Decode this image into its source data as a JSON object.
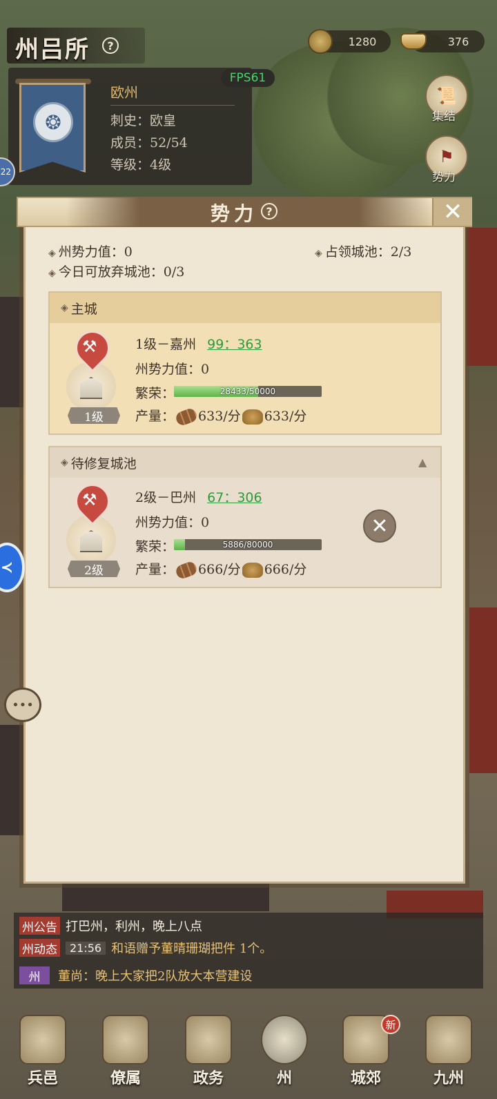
{
  "header": {
    "title": "州吕所",
    "help_icon": "?",
    "coins": "1280",
    "ingots": "376",
    "fps": "FPS61"
  },
  "state_card": {
    "name": "欧州",
    "governor": "刺史：欧皇",
    "members": "成员：52/54",
    "level": "等级：4级"
  },
  "side_buttons": {
    "rally": "集结",
    "power": "势力"
  },
  "left_avatar_level": "22",
  "modal": {
    "title": "势力",
    "close": "✕",
    "state_power": "州势力值：0",
    "occupied": "占领城池：2/3",
    "abandon_today": "今日可放弃城池：0/3",
    "sections": [
      {
        "heading": "主城",
        "city": {
          "level_badge": "1级",
          "name": "1级－嘉州",
          "coords": "99：363",
          "power": "州势力值：0",
          "prosperity_label": "繁荣：",
          "prosperity_text": "28433/50000",
          "prosperity_fraction": 0.5687,
          "output_label": "产量：",
          "wood": "633/分",
          "grain": "633/分"
        }
      },
      {
        "heading": "待修复城池",
        "city": {
          "level_badge": "2级",
          "name": "2级－巴州",
          "coords": "67：306",
          "power": "州势力值：0",
          "prosperity_label": "繁荣：",
          "prosperity_text": "5886/80000",
          "prosperity_fraction": 0.0736,
          "output_label": "产量：",
          "wood": "666/分",
          "grain": "666/分"
        }
      }
    ]
  },
  "chat": {
    "announcement_tag": "州公告",
    "announcement": "打巴州，利州，晚上八点",
    "dynamic_tag": "州动态",
    "dynamic_time": "21:56",
    "dynamic_text": "和语赠予董晴珊瑚把件 1个。",
    "channel_tag": "州",
    "message": "董尚：晚上大家把2队放大本营建设"
  },
  "nav": {
    "items": [
      "兵邑",
      "僚属",
      "政务",
      "州",
      "城郊",
      "九州"
    ],
    "new_badge": "新"
  },
  "colors": {
    "accent_green": "#2f9a3c",
    "fps_green": "#48d66a",
    "chat_red": "#a33b30",
    "chat_purple": "#7c4f9e"
  }
}
